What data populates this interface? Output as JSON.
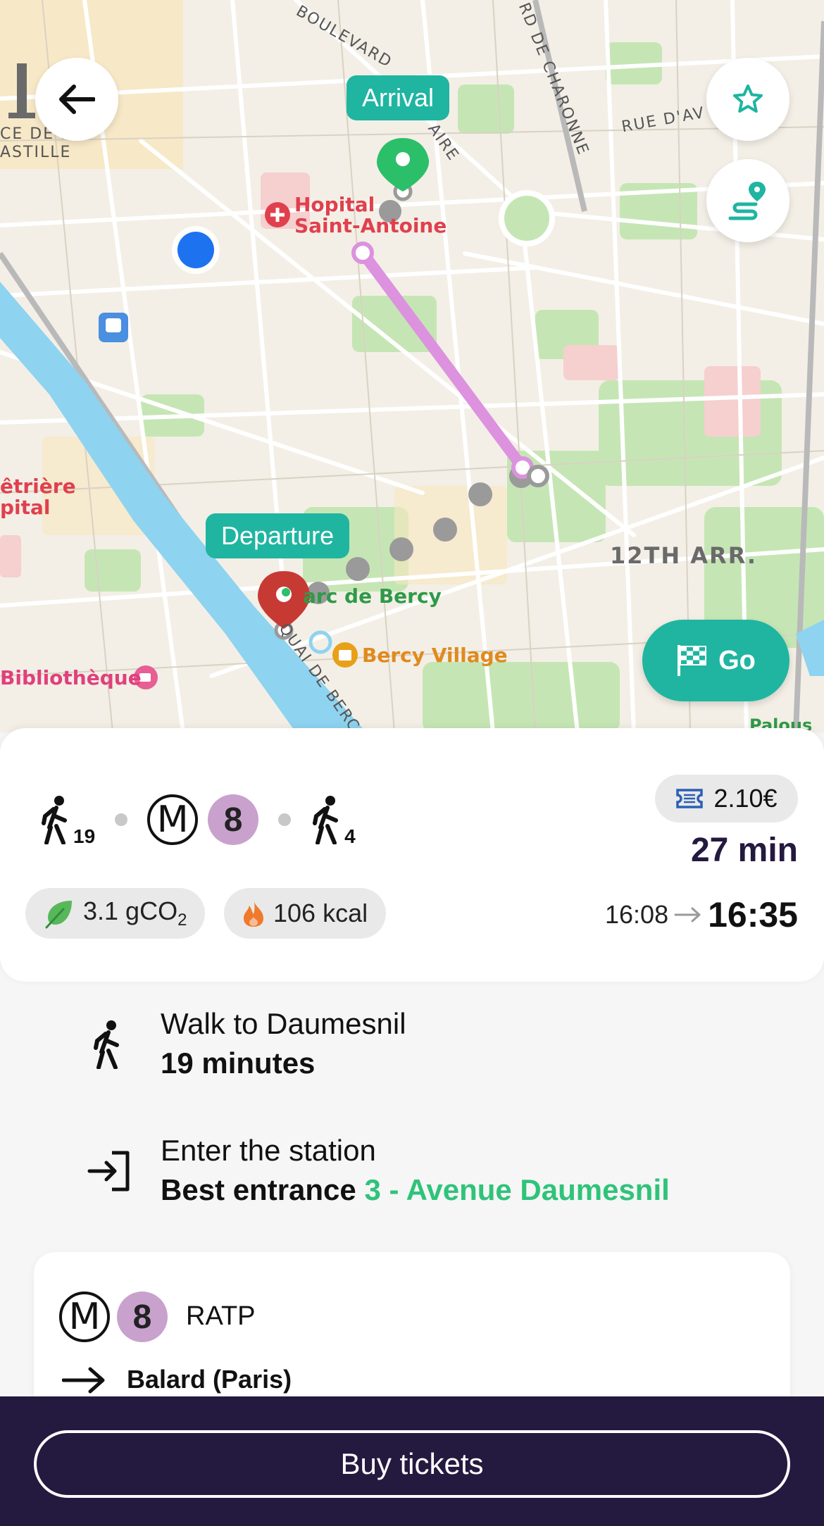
{
  "map": {
    "labels": {
      "boulevard": "BOULEVARD",
      "aire": "AIRE",
      "charonne": "RD DE CHARONNE",
      "rue_dav": "RUE D'AV",
      "place_bastille_1": "CE DE B",
      "place_bastille_2": "ASTILLE",
      "hopital_1": "Hopital",
      "hopital_2": "Saint-Antoine",
      "salpetriere_1": "êtrière",
      "salpetriere_2": "pital",
      "parc_bercy": "arc de Bercy",
      "bercy_village": "Bercy Village",
      "bibliotheque": "Bibliothèque",
      "quai_bercy": "QUAI DE BERC",
      "arrondissement": "12TH ARR.",
      "palous": "Palous"
    },
    "arrival_tag": "Arrival",
    "departure_tag": "Departure",
    "go_label": "Go",
    "icons": [
      "back-arrow-icon",
      "star-icon",
      "route-icon",
      "checkered-flag-icon"
    ],
    "route_color": "#dc92de",
    "accent": "#1fb5a1"
  },
  "summary": {
    "walk_start_minutes": "19",
    "walk_end_minutes": "4",
    "metro_letter": "M",
    "line_number": "8",
    "price": "2.10€",
    "duration": "27 min",
    "co2_value": "3.1 gCO",
    "co2_sub": "2",
    "calories": "106 kcal",
    "depart_time": "16:08",
    "arrive_time": "16:35"
  },
  "steps": {
    "walk_title": "Walk to Daumesnil",
    "walk_sub": "19 minutes",
    "enter_title": "Enter the station",
    "enter_sub_prefix": "Best entrance",
    "enter_sub_highlight": "3 - Avenue Daumesnil"
  },
  "line_card": {
    "metro_letter": "M",
    "line_number": "8",
    "operator": "RATP",
    "direction": "Balard (Paris)"
  },
  "footer": {
    "buy_label": "Buy tickets"
  }
}
